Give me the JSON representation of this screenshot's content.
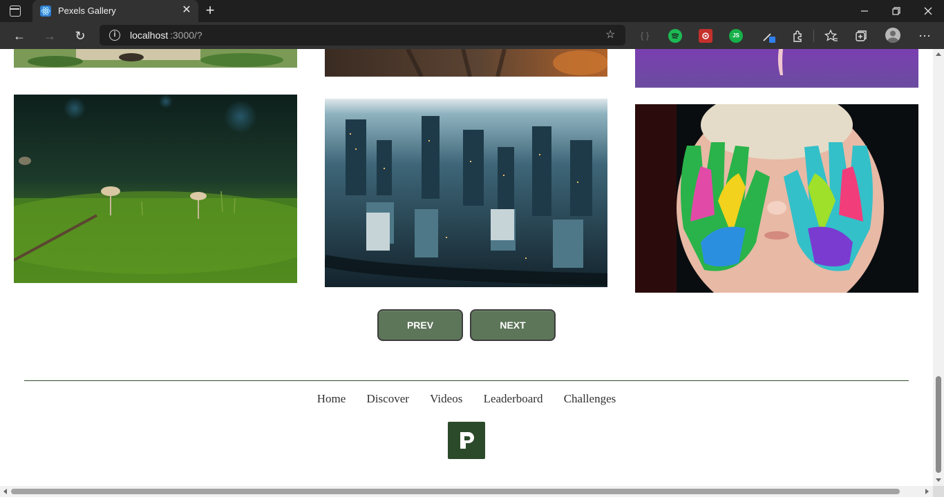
{
  "browser": {
    "tab_title": "Pexels Gallery",
    "url_host": "localhost",
    "url_rest": ":3000/?",
    "close_glyph": "✕",
    "new_tab_glyph": "+",
    "minimize_glyph": "—",
    "restore_glyph": "❐",
    "window_close_glyph": "✕",
    "back_glyph": "←",
    "forward_glyph": "→",
    "reload_glyph": "↻",
    "info_glyph": "i",
    "star_glyph": "☆",
    "extensions": [
      {
        "name": "json-viewer-extension-icon",
        "color": "#3a3a3a",
        "label": "{ }"
      },
      {
        "name": "spotify-extension-icon",
        "color": "#1db954",
        "label": ""
      },
      {
        "name": "red-extension-icon",
        "color": "#c4302b",
        "label": ""
      },
      {
        "name": "js-extension-icon",
        "color": "#17b04a",
        "label": "JS"
      },
      {
        "name": "color-picker-extension-icon",
        "color": "#2f80ed",
        "label": ""
      }
    ],
    "toolbar_icons": {
      "extensions": "⧉",
      "favorites": "☆",
      "collections": "⧈",
      "menu": "⋯"
    }
  },
  "gallery": {
    "images": [
      {
        "name": "photo-forest-floor-top",
        "alt": "forest floor"
      },
      {
        "name": "photo-forest-path-top",
        "alt": "forest path"
      },
      {
        "name": "photo-purple-ballet-top",
        "alt": "dancer on purple"
      },
      {
        "name": "photo-mushrooms-moss",
        "alt": "mushrooms in moss"
      },
      {
        "name": "photo-city-aerial",
        "alt": "city aerial view"
      },
      {
        "name": "photo-painted-hands",
        "alt": "child with painted hands"
      }
    ]
  },
  "pagination": {
    "prev_label": "PREV",
    "next_label": "NEXT"
  },
  "footer": {
    "links": [
      "Home",
      "Discover",
      "Videos",
      "Leaderboard",
      "Challenges"
    ],
    "logo_letter": "P"
  }
}
